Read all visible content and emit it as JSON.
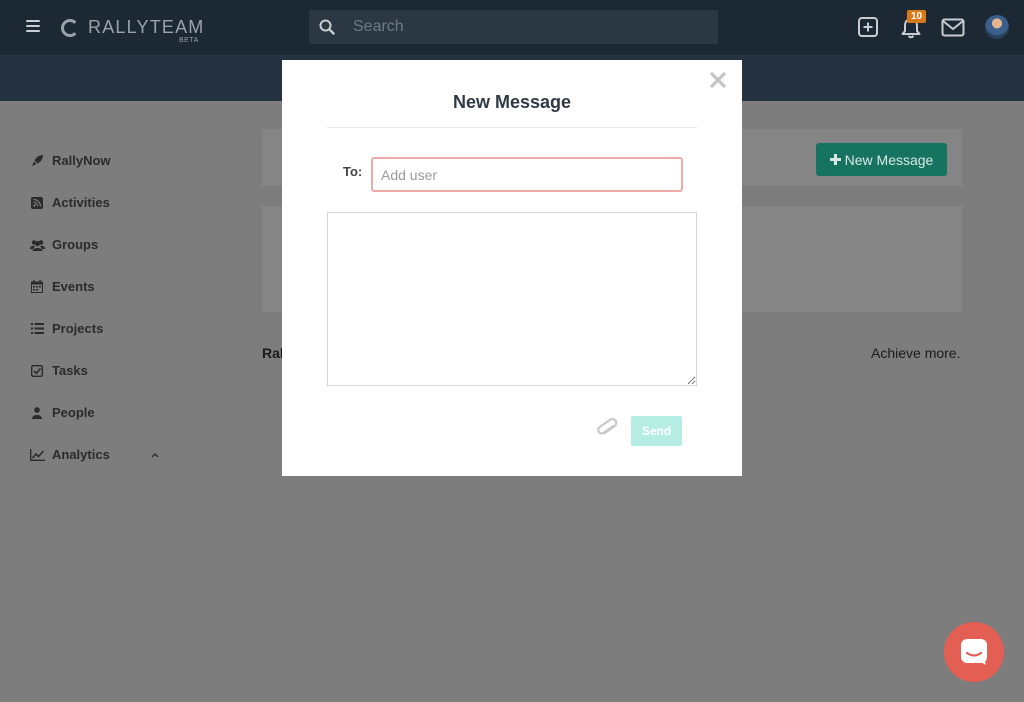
{
  "app": {
    "logo_text": "RALLYTEAM",
    "logo_badge": "BETA"
  },
  "header": {
    "search_placeholder": "Search",
    "notification_count": "10",
    "icons": [
      "menu-icon",
      "plus-square-icon",
      "bell-icon",
      "envelope-icon",
      "user-avatar"
    ]
  },
  "sidebar": {
    "items": [
      {
        "label": "RallyNow",
        "icon": "rocket-icon"
      },
      {
        "label": "Activities",
        "icon": "rss-icon"
      },
      {
        "label": "Groups",
        "icon": "users-icon"
      },
      {
        "label": "Events",
        "icon": "calendar-icon"
      },
      {
        "label": "Projects",
        "icon": "list-icon"
      },
      {
        "label": "Tasks",
        "icon": "check-square-icon"
      },
      {
        "label": "People",
        "icon": "user-icon"
      },
      {
        "label": "Analytics",
        "icon": "line-chart-icon"
      }
    ]
  },
  "main": {
    "new_message_button": "New Message",
    "footer_left": "Ral",
    "footer_right": "Achieve more."
  },
  "modal": {
    "title": "New Message",
    "to_label": "To:",
    "to_placeholder": "Add user",
    "send_label": "Send"
  },
  "colors": {
    "topbar": "#1c2833",
    "accent": "#16735f",
    "badge": "#d67a19",
    "chat": "#e35f54",
    "send_disabled": "#b5ede3"
  }
}
